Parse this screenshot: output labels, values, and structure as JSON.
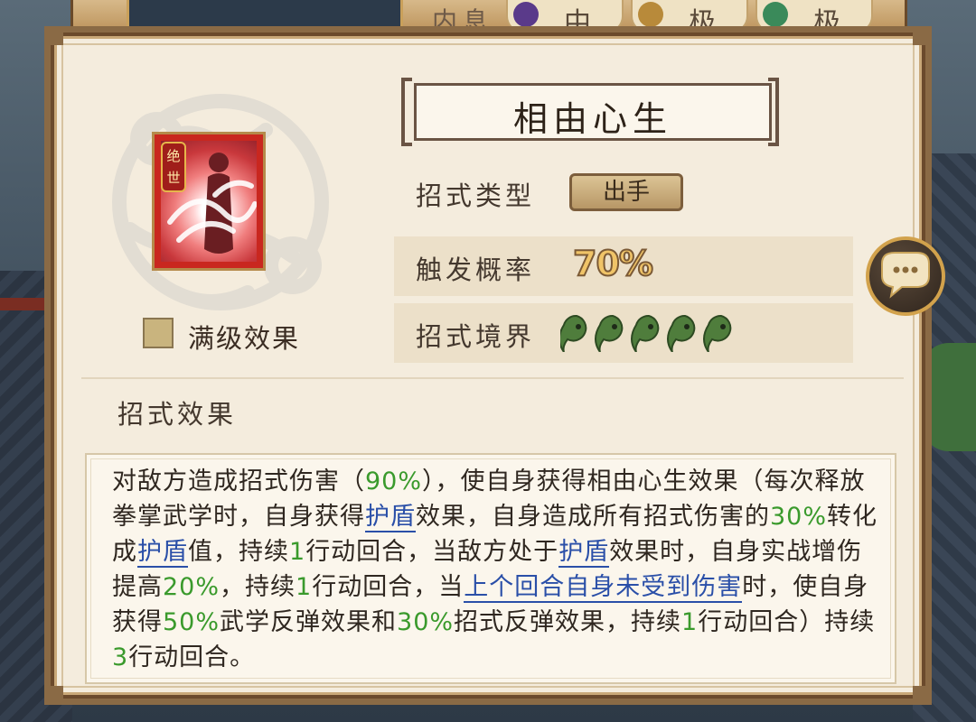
{
  "background": {
    "top_bar_label": "内息",
    "pills": [
      {
        "text": "中",
        "color": "#5a3a8a"
      },
      {
        "text": "极",
        "color": "#b88a3a"
      },
      {
        "text": "极",
        "color": "#3a8a5a"
      }
    ]
  },
  "skill": {
    "name": "相由心生",
    "tag": "绝世",
    "max_effect_label": "满级效果",
    "max_effect_checked": false,
    "icon": "palm-figure-icon"
  },
  "rows": {
    "type_label": "招式类型",
    "type_value": "出手",
    "rate_label": "触发概率",
    "rate_value": "70%",
    "realm_label": "招式境界",
    "realm_level": 5,
    "realm_max": 5
  },
  "effect_title": "招式效果",
  "description": {
    "p1": "对敌方造成招式伤害（",
    "v1": "90%",
    "p2": "），使自身获得相由心生效果（每次释放拳掌武学时，自身获得",
    "k1": "护盾",
    "p3": "效果，自身造成所有招式伤害的",
    "v2": "30%",
    "p4": "转化成",
    "k2": "护盾",
    "p5": "值，持续",
    "v3": "1",
    "p6": "行动回合，当敌方处于",
    "k3": "护盾",
    "p7": "效果时，自身实战增伤提高",
    "v4": "20%",
    "p8": "，持续",
    "v5": "1",
    "p9": "行动回合，当",
    "k4": "上个回合自身未受到伤害",
    "p10": "时，使自身获得",
    "v6": "50%",
    "p11": "武学反弹效果和",
    "v7": "30%",
    "p12": "招式反弹效果，持续",
    "v8": "1",
    "p13": "行动回合）持续",
    "v9": "3",
    "p14": "行动回合。"
  },
  "colors": {
    "highlight_value": "#3a9a2c",
    "keyword": "#2a4fa8",
    "rate_fill": "#f0c468",
    "gem": "#4f7d3c"
  }
}
